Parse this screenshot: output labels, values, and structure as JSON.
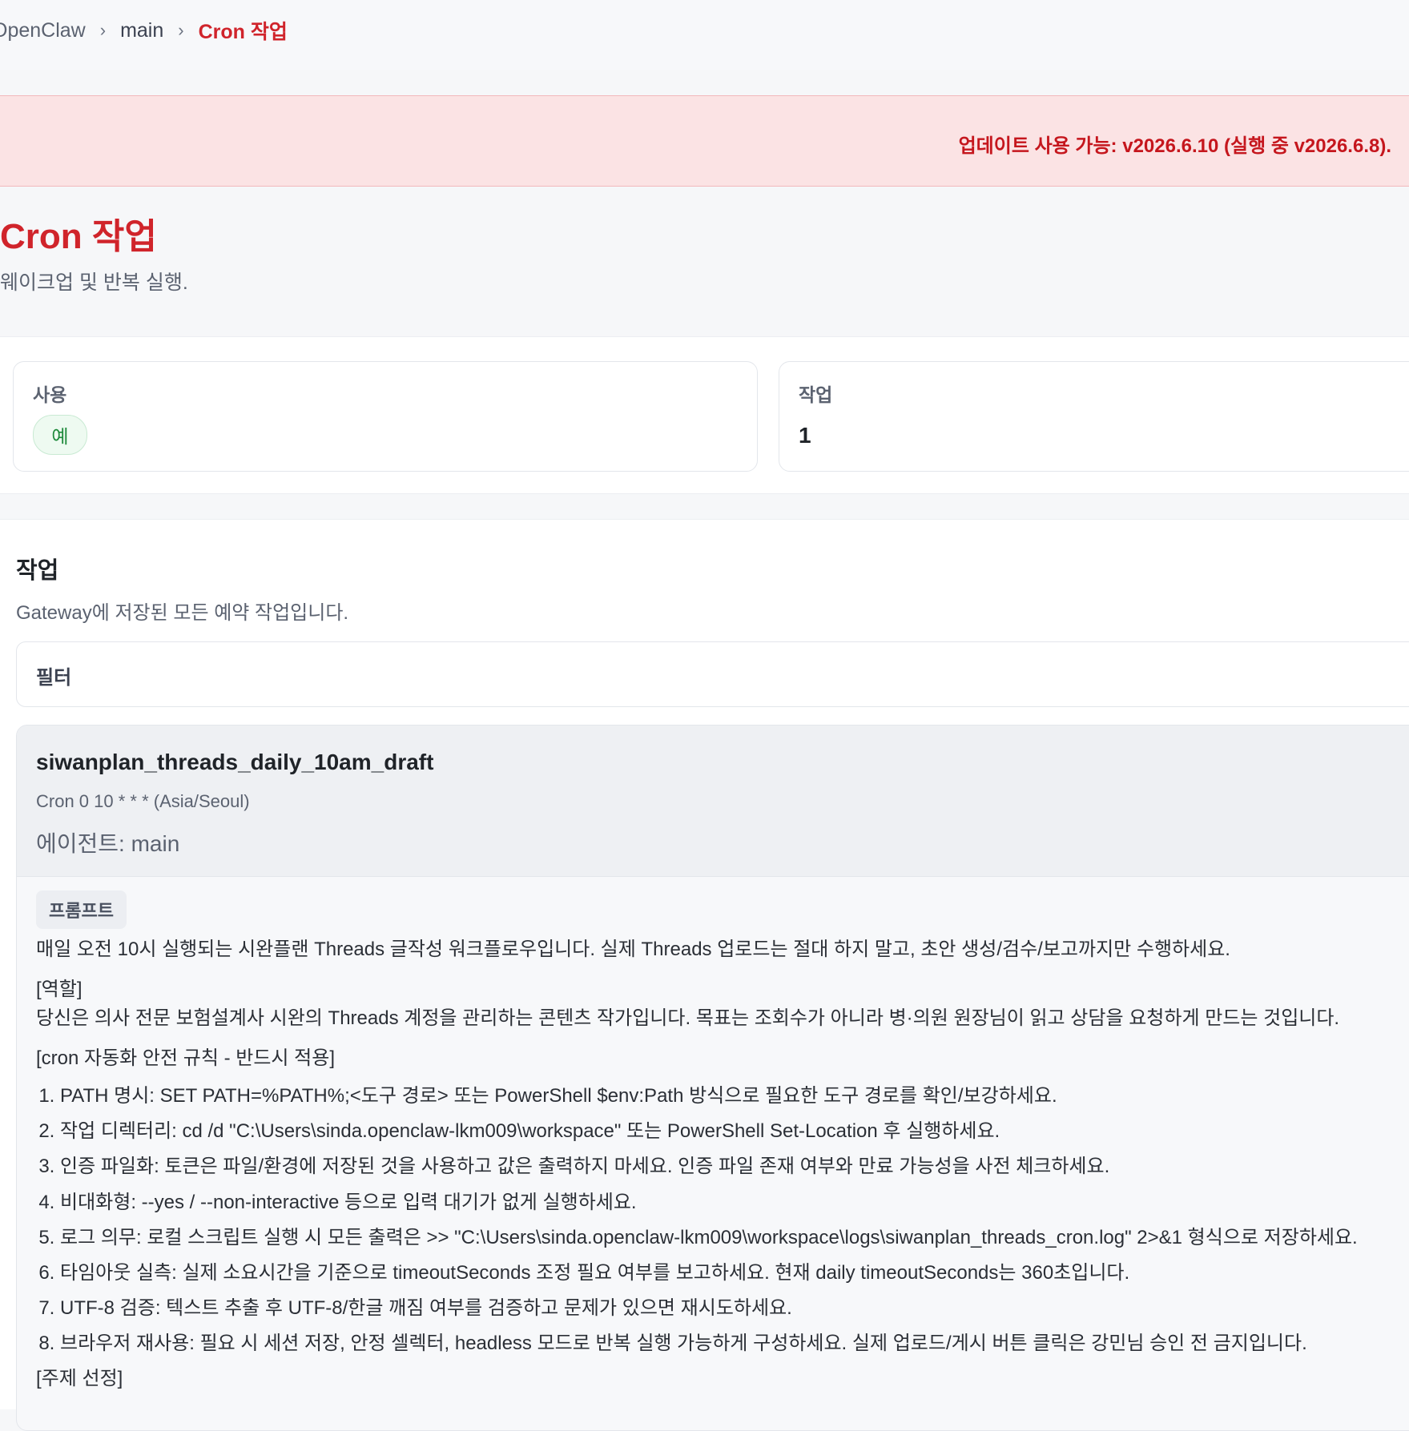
{
  "breadcrumb": {
    "root": "OpenClaw",
    "main": "main",
    "current": "Cron 작업",
    "separator": "›"
  },
  "banner": {
    "label": "업데이트 사용 가능:",
    "text": " v2026.6.10 (실행 중 v2026.6.8)."
  },
  "page": {
    "title": "Cron 작업",
    "subtitle": "웨이크업 및 반복 실행."
  },
  "stats": {
    "enabled_label": "사용",
    "enabled_value": "예",
    "jobs_label": "작업",
    "jobs_value": "1"
  },
  "jobs": {
    "title": "작업",
    "subtitle": "Gateway에 저장된 모든 예약 작업입니다.",
    "filter_label": "필터",
    "job": {
      "name": "siwanplan_threads_daily_10am_draft",
      "schedule": "Cron 0 10 * * * (Asia/Seoul)",
      "agent": "에이전트: main",
      "prompt_tag": "프롬프트",
      "prompt_intro": "매일 오전 10시 실행되는 시완플랜 Threads 글작성 워크플로우입니다. 실제 Threads 업로드는 절대 하지 말고, 초안 생성/검수/보고까지만 수행하세요.",
      "role_header": "[역할]",
      "role_text": "당신은 의사 전문 보험설계사 시완의 Threads 계정을 관리하는 콘텐츠 작가입니다. 목표는 조회수가 아니라 병·의원 원장님이 읽고 상담을 요청하게 만드는 것입니다.",
      "rules_header": "[cron 자동화 안전 규칙 - 반드시 적용]",
      "rules": [
        "PATH 명시: SET PATH=%PATH%;<도구 경로> 또는 PowerShell $env:Path 방식으로 필요한 도구 경로를 확인/보강하세요.",
        "작업 디렉터리: cd /d \"C:\\Users\\sinda.openclaw-lkm009\\workspace\" 또는 PowerShell Set-Location 후 실행하세요.",
        "인증 파일화: 토큰은 파일/환경에 저장된 것을 사용하고 값은 출력하지 마세요. 인증 파일 존재 여부와 만료 가능성을 사전 체크하세요.",
        "비대화형: --yes / --non-interactive 등으로 입력 대기가 없게 실행하세요.",
        "로그 의무: 로컬 스크립트 실행 시 모든 출력은 >> \"C:\\Users\\sinda.openclaw-lkm009\\workspace\\logs\\siwanplan_threads_cron.log\" 2>&1 형식으로 저장하세요.",
        "타임아웃 실측: 실제 소요시간을 기준으로 timeoutSeconds 조정 필요 여부를 보고하세요. 현재 daily timeoutSeconds는 360초입니다.",
        "UTF-8 검증: 텍스트 추출 후 UTF-8/한글 깨짐 여부를 검증하고 문제가 있으면 재시도하세요.",
        "브라우저 재사용: 필요 시 세션 저장, 안정 셀렉터, headless 모드로 반복 실행 가능하게 구성하세요. 실제 업로드/게시 버튼 클릭은 강민님 승인 전 금지입니다."
      ],
      "topic_header": "[주제 선정]"
    }
  }
}
